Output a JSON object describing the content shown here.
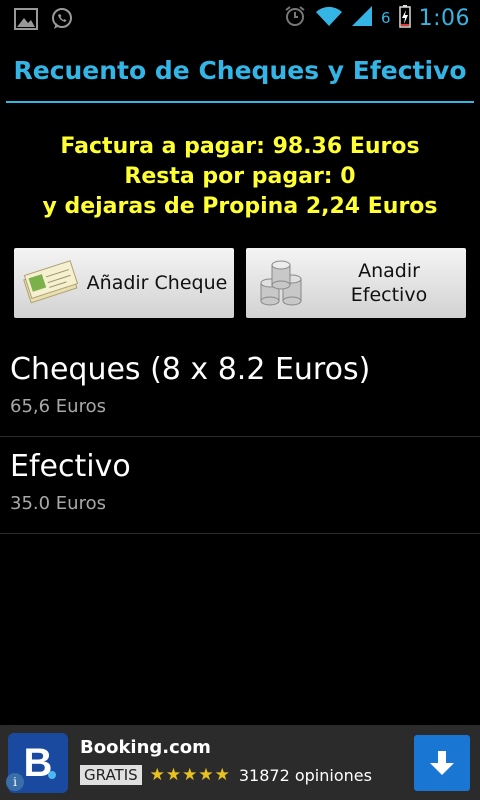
{
  "status_bar": {
    "time": "1:06",
    "battery_level": "6",
    "icons": [
      "image-icon",
      "whatsapp-icon",
      "alarm-icon",
      "wifi-icon",
      "signal-icon",
      "battery-charging-icon"
    ]
  },
  "title": "Recuento de Cheques y Efectivo",
  "summary": {
    "line1": "Factura a pagar: 98.36 Euros",
    "line2": "Resta por pagar: 0",
    "line3": "y dejaras de Propina 2,24 Euros"
  },
  "buttons": {
    "add_cheque": "Añadir Cheque",
    "add_efectivo_line1": "Anadir",
    "add_efectivo_line2": "Efectivo"
  },
  "list": [
    {
      "title": "Cheques (8 x 8.2 Euros)",
      "subtitle": "65,6 Euros"
    },
    {
      "title": "Efectivo",
      "subtitle": "35.0 Euros"
    }
  ],
  "ad": {
    "name": "Booking.com",
    "badge": "GRATIS",
    "stars": "★★★★★",
    "rating": 4.5,
    "reviews": "31872 opiniones",
    "logo_letter": "B",
    "info": "i"
  },
  "colors": {
    "accent": "#33b5e5",
    "summary_text": "#ffff33",
    "ad_logo": "#1a4aa0",
    "ad_download": "#1976d2"
  }
}
